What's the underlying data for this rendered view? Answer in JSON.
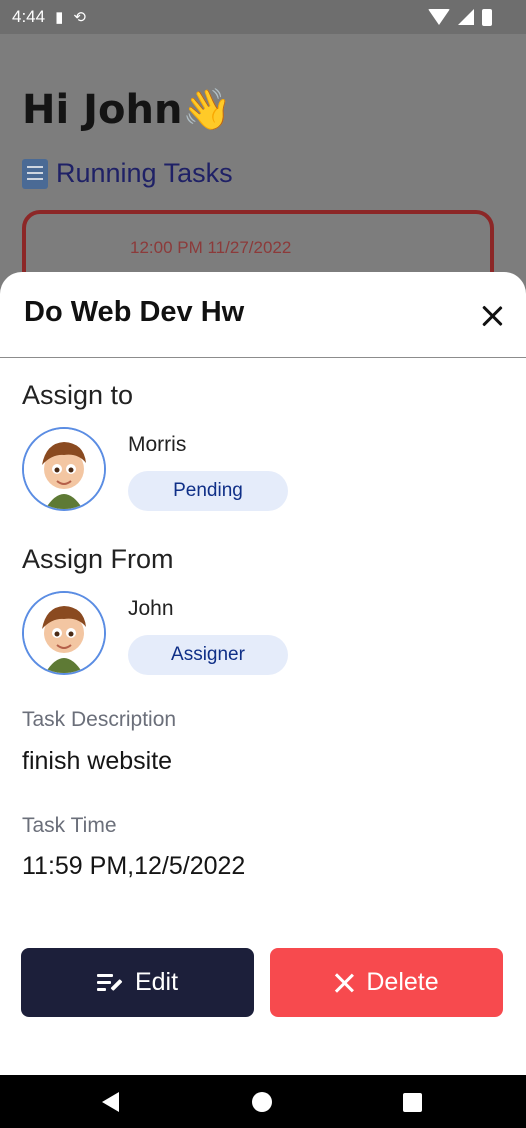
{
  "status_bar": {
    "time": "4:44",
    "icons": [
      "sd-card-icon",
      "sync-icon",
      "wifi-icon",
      "cellular-icon",
      "battery-icon"
    ]
  },
  "background": {
    "greeting": "Hi John👋",
    "section_title": "Running Tasks",
    "card_time": "12:00 PM 11/27/2022"
  },
  "sheet": {
    "title": "Do Web Dev Hw",
    "assign_to": {
      "label": "Assign to",
      "name": "Morris",
      "status": "Pending"
    },
    "assign_from": {
      "label": "Assign From",
      "name": "John",
      "role": "Assigner"
    },
    "description": {
      "label": "Task Description",
      "value": "finish website"
    },
    "time": {
      "label": "Task Time",
      "value": "11:59 PM,12/5/2022"
    },
    "buttons": {
      "edit": "Edit",
      "delete": "Delete"
    }
  },
  "colors": {
    "accent_dark": "#1c1f3a",
    "danger": "#f74a4e",
    "chip_bg": "#e5ecfa",
    "chip_text": "#0f2f87",
    "avatar_ring": "#5b8de3"
  }
}
